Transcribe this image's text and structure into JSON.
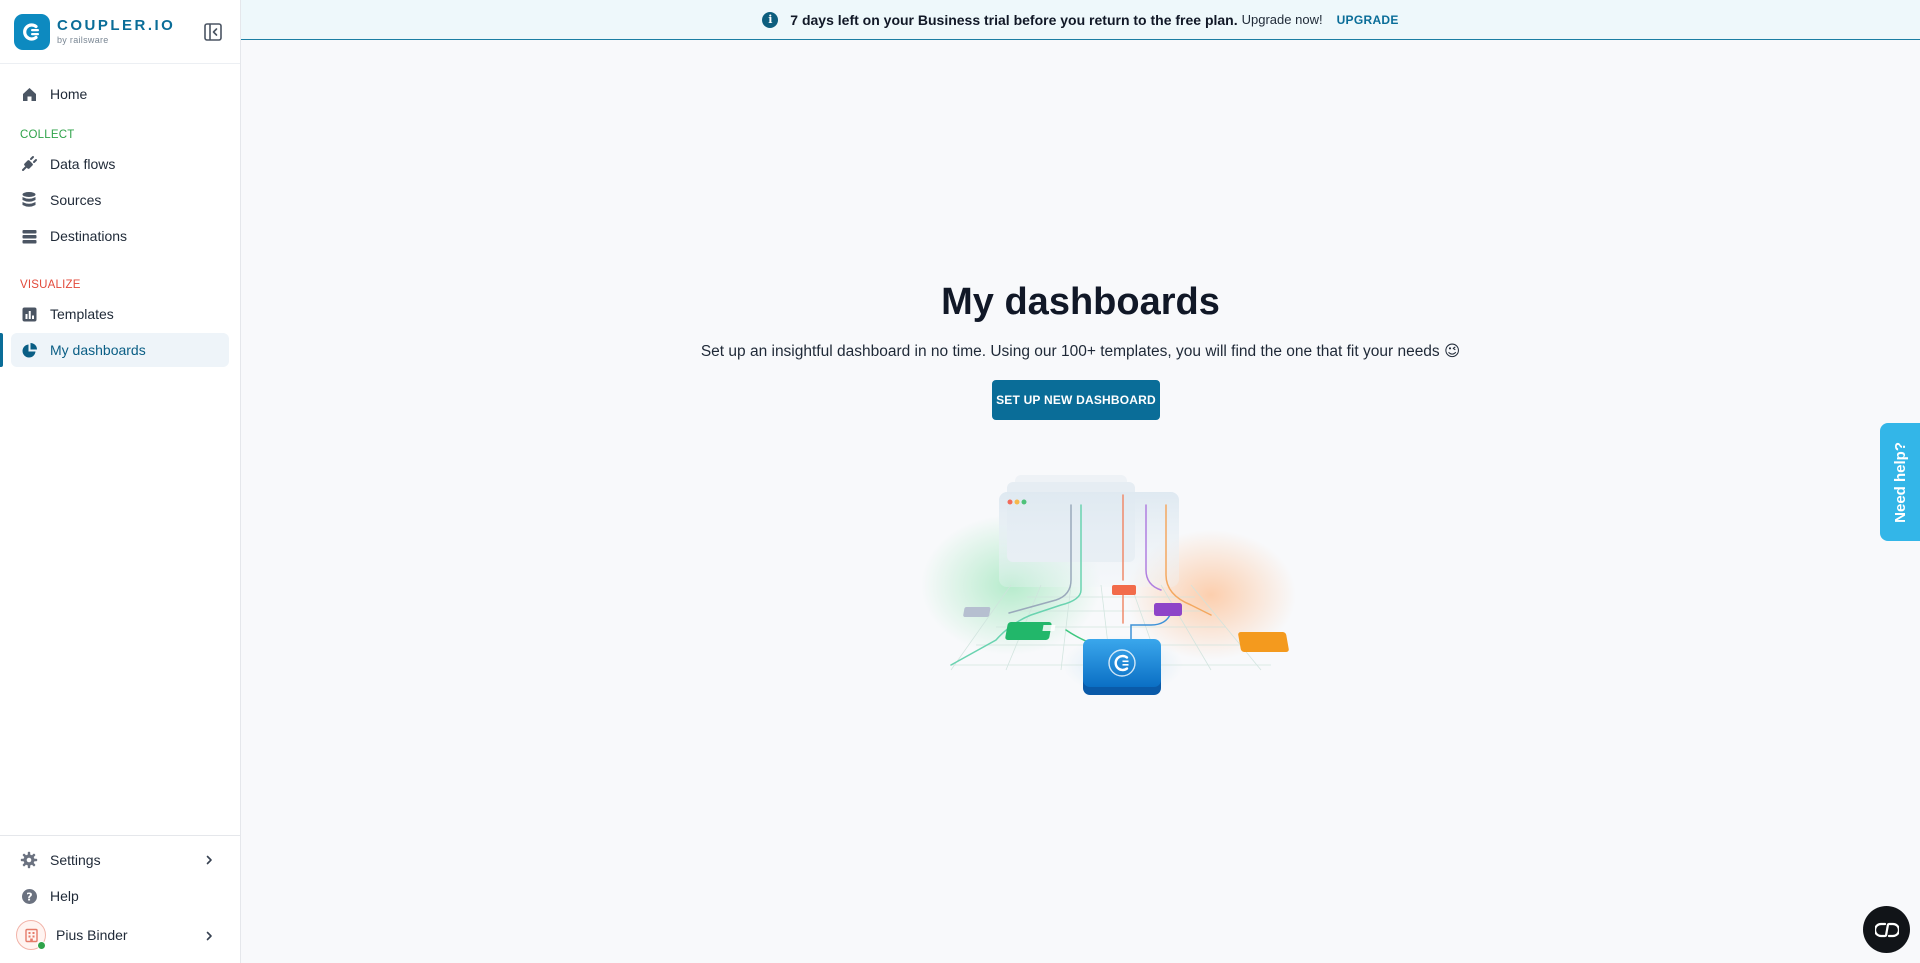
{
  "brand": {
    "name": "COUPLER.IO",
    "subtitle": "by railsware",
    "color": "#0a6d98"
  },
  "banner": {
    "strong_text": "7 days left on your Business trial before you return to the free plan.",
    "normal_text": "Upgrade now!",
    "link_label": "UPGRADE"
  },
  "sidebar": {
    "home": "Home",
    "sections": {
      "collect": "COLLECT",
      "visualize": "VISUALIZE"
    },
    "collect_items": [
      "Data flows",
      "Sources",
      "Destinations"
    ],
    "visualize_items": [
      "Templates",
      "My dashboards"
    ],
    "active_item": "My dashboards",
    "bottom": {
      "settings": "Settings",
      "help": "Help",
      "user_name": "Pius Binder"
    }
  },
  "main": {
    "title": "My dashboards",
    "subtitle": "Set up an insightful dashboard in no time. Using our 100+ templates, you will find the one that fit your needs 😉",
    "cta_label": "SET UP NEW DASHBOARD"
  },
  "widgets": {
    "need_help": "Need help?"
  },
  "colors": {
    "accent": "#0a6d98",
    "collect": "#2fa34a",
    "visualize": "#e24a3b",
    "help_tab": "#33b6e8"
  }
}
